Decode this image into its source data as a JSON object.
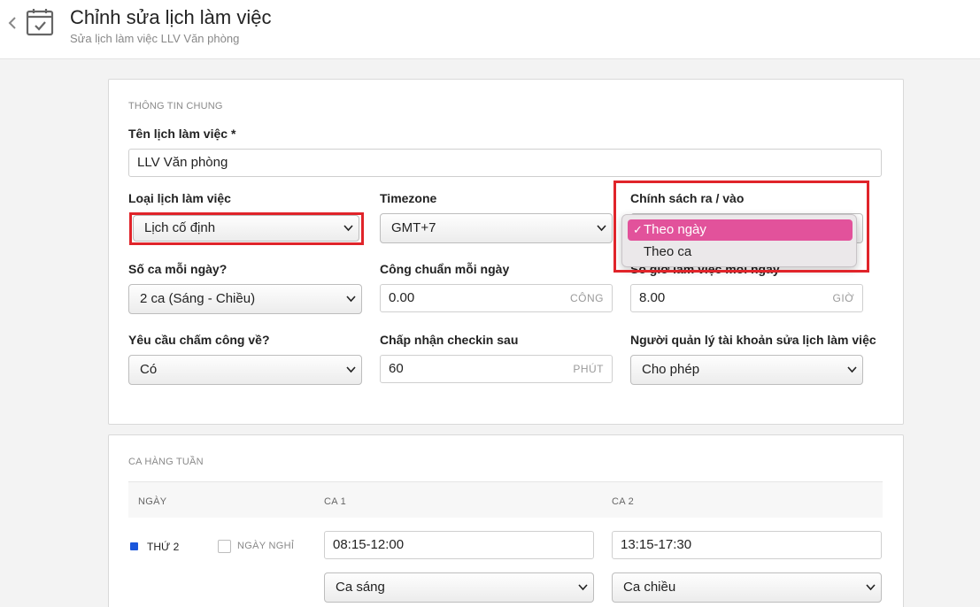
{
  "header": {
    "title": "Chỉnh sửa lịch làm việc",
    "subtitle": "Sửa lịch làm việc LLV Văn phòng"
  },
  "general": {
    "section_label": "THÔNG TIN CHUNG",
    "name_label": "Tên lịch làm việc *",
    "name_value": "LLV Văn phòng",
    "type_label": "Loại lịch làm việc",
    "type_value": "Lịch cố định",
    "timezone_label": "Timezone",
    "timezone_value": "GMT+7",
    "policy_label": "Chính sách ra / vào",
    "policy_options": [
      "Theo ngày",
      "Theo ca"
    ],
    "policy_selected": "Theo ngày",
    "shifts_label": "Số ca mỗi ngày?",
    "shifts_value": "2 ca (Sáng - Chiều)",
    "workday_label": "Công chuẩn mỗi ngày",
    "workday_value": "0.00",
    "workday_unit": "CÔNG",
    "hours_label": "Số giờ làm việc mỗi ngày",
    "hours_value": "8.00",
    "hours_unit": "GIỜ",
    "checkout_label": "Yêu cầu chấm công về?",
    "checkout_value": "Có",
    "checkin_label": "Chấp nhận checkin sau",
    "checkin_value": "60",
    "checkin_unit": "PHÚT",
    "manager_label": "Người quản lý tài khoản sửa lịch làm việc",
    "manager_value": "Cho phép"
  },
  "weekly": {
    "section_label": "CA HÀNG TUẦN",
    "col_day": "NGÀY",
    "col_shift1": "CA 1",
    "col_shift2": "CA 2",
    "rows": [
      {
        "day": "THỨ 2",
        "off_label": "NGÀY NGHỈ",
        "shift1_time": "08:15-12:00",
        "shift1_name": "Ca sáng",
        "shift2_time": "13:15-17:30",
        "shift2_name": "Ca chiều"
      }
    ]
  },
  "colors": {
    "highlight": "#e0242a",
    "selected_option": "#e2529b",
    "day_bullet": "#1a56db"
  }
}
